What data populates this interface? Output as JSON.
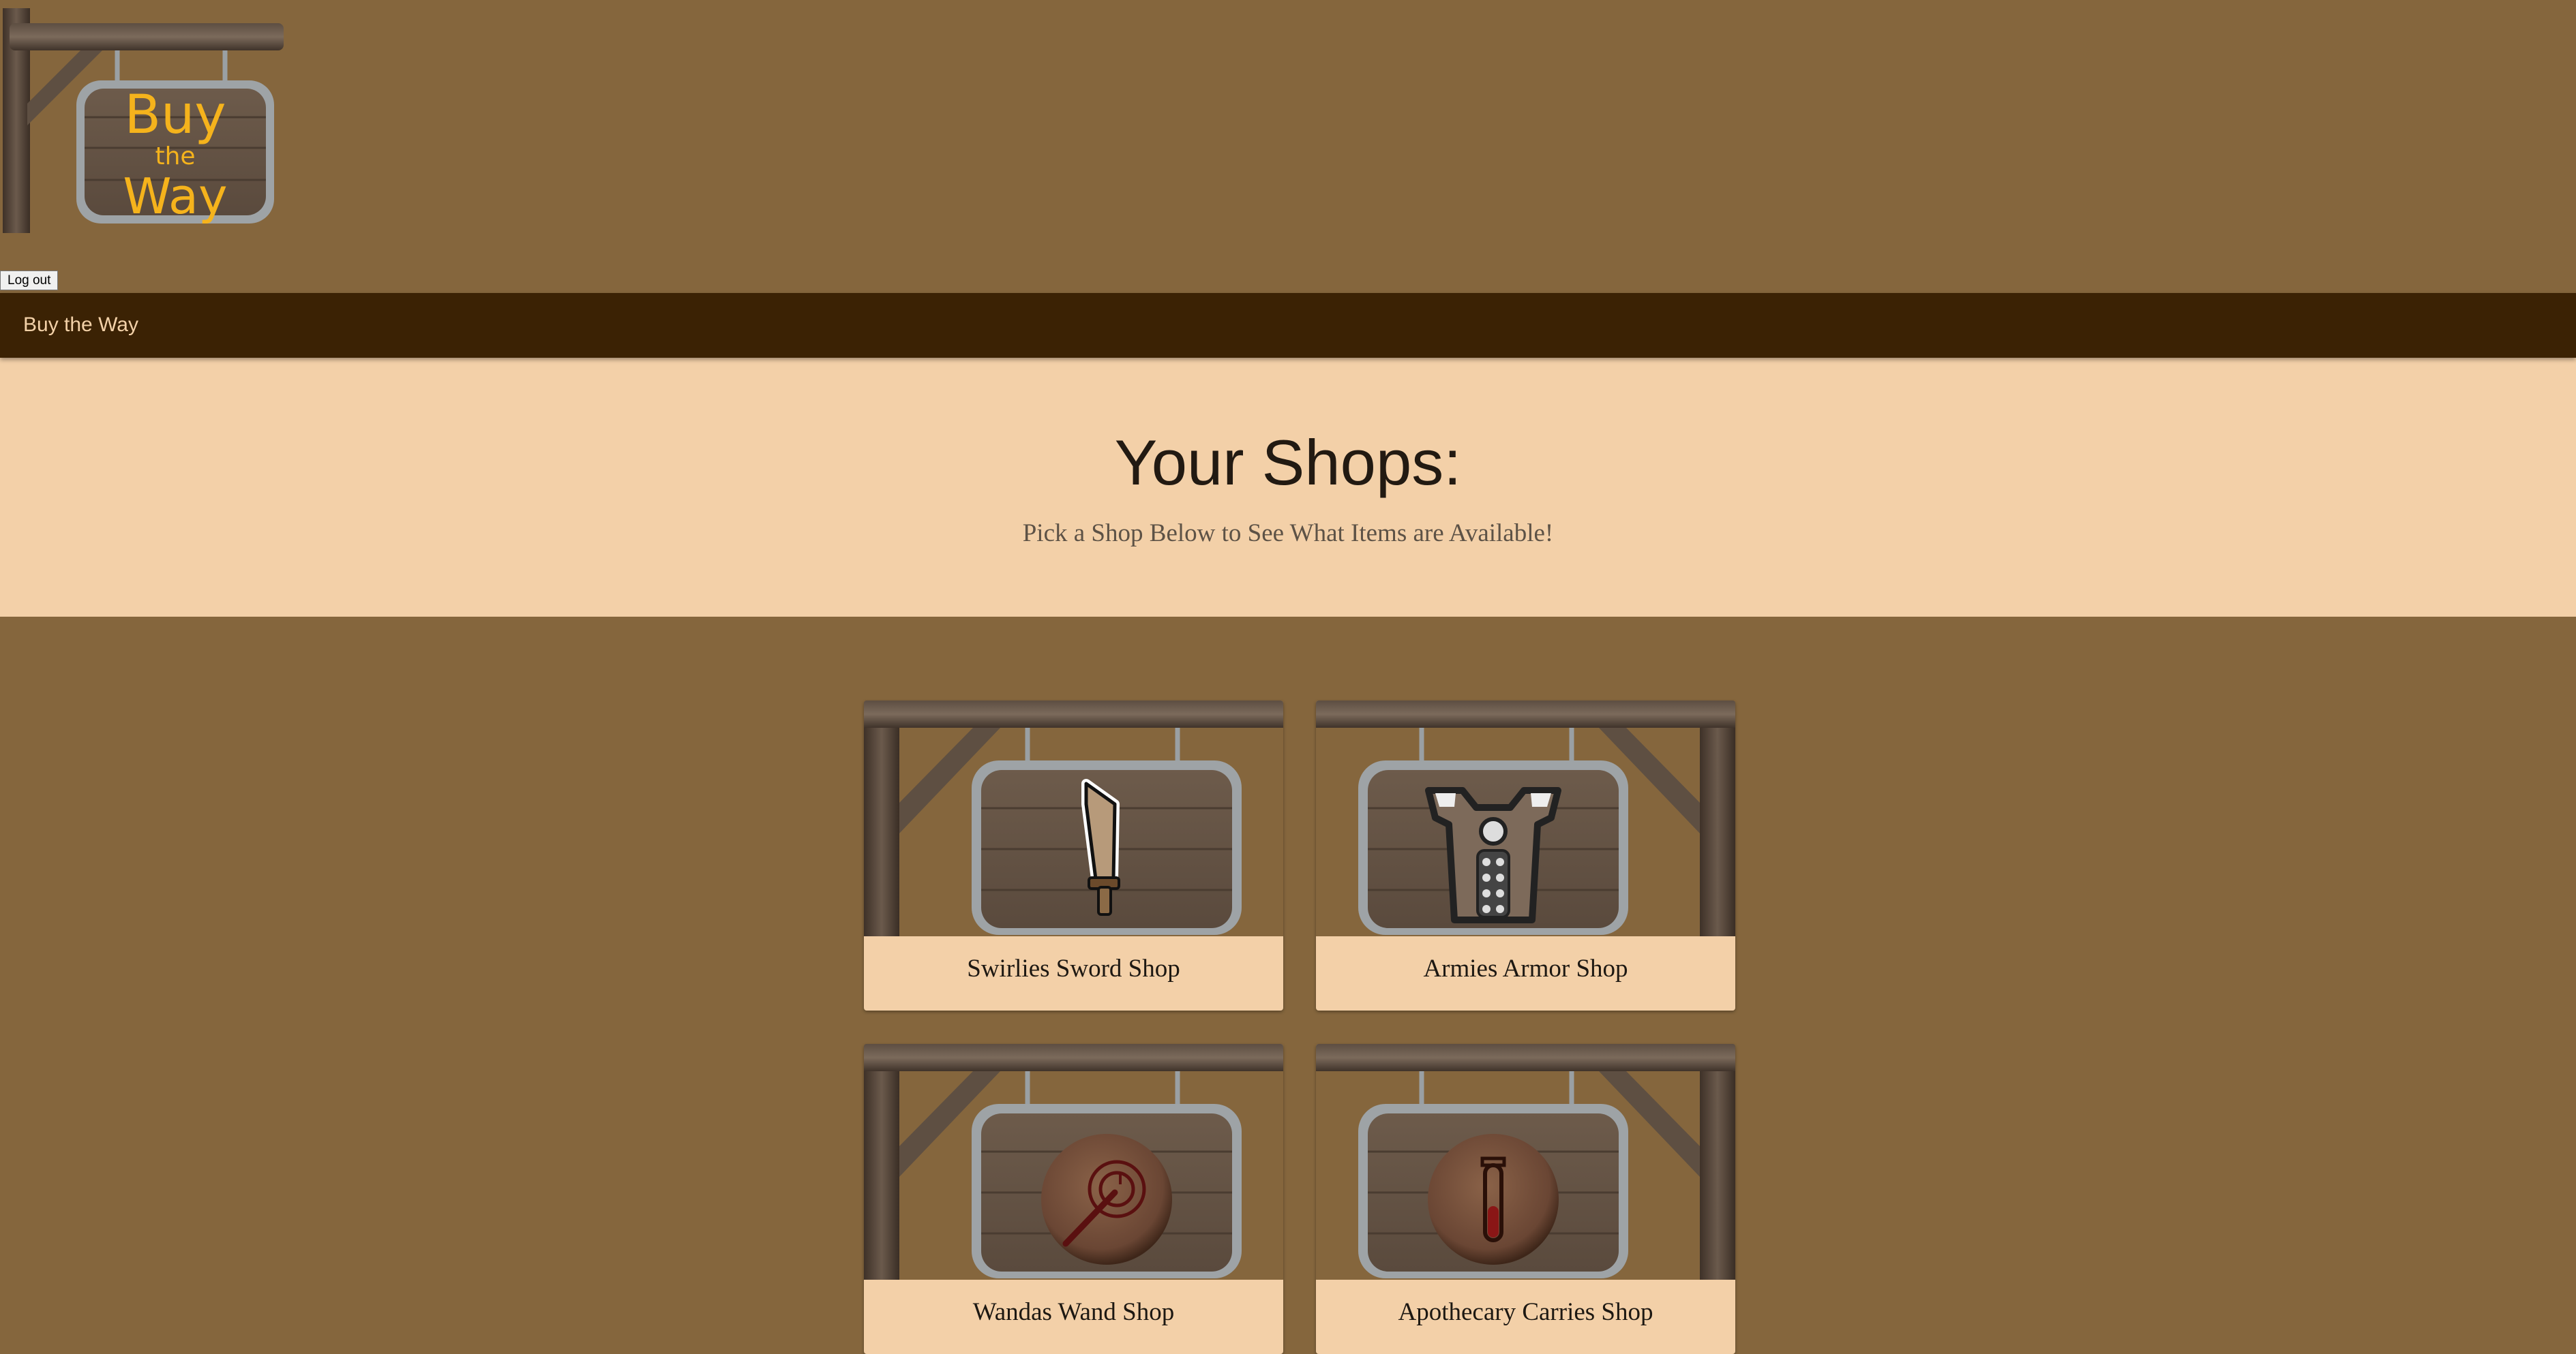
{
  "logo": {
    "line1": "Buy",
    "line2": "the",
    "line3": "Way"
  },
  "auth": {
    "logout_label": "Log out"
  },
  "navbar": {
    "brand": "Buy the Way"
  },
  "hero": {
    "title": "Your Shops:",
    "subtitle": "Pick a Shop Below to See What Items are Available!"
  },
  "shops": [
    {
      "name": "Swirlies Sword Shop",
      "icon": "sword-icon"
    },
    {
      "name": "Armies Armor Shop",
      "icon": "armor-icon"
    },
    {
      "name": "Wandas Wand Shop",
      "icon": "wand-icon"
    },
    {
      "name": "Apothecary Carries Shop",
      "icon": "potion-icon"
    }
  ],
  "colors": {
    "page_background": "#85663d",
    "navbar": "#3b2204",
    "panel": "#f3d0a8",
    "logo_text": "#f5b31c"
  }
}
